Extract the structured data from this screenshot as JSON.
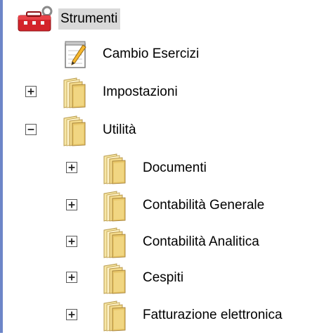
{
  "tree": {
    "root": {
      "label": "Strumenti",
      "icon": "toolbox-icon",
      "state": "selected"
    },
    "items": [
      {
        "label": "Cambio Esercizi",
        "icon": "notepad-pencil-icon",
        "expander": "none"
      },
      {
        "label": "Impostazioni",
        "icon": "folder-icon",
        "expander": "plus"
      },
      {
        "label": "Utilità",
        "icon": "folder-icon",
        "expander": "minus"
      }
    ],
    "utilita_children": [
      {
        "label": "Documenti",
        "icon": "folder-icon",
        "expander": "plus"
      },
      {
        "label": "Contabilità Generale",
        "icon": "folder-icon",
        "expander": "plus"
      },
      {
        "label": "Contabilità Analitica",
        "icon": "folder-icon",
        "expander": "plus"
      },
      {
        "label": "Cespiti",
        "icon": "folder-icon",
        "expander": "plus"
      },
      {
        "label": "Fatturazione elettronica",
        "icon": "folder-icon",
        "expander": "plus"
      }
    ]
  },
  "colors": {
    "selection_background": "#d9d9d9",
    "left_rule": "#6d86c8",
    "folder_light": "#fbeaa5",
    "folder_dark": "#d6b35a",
    "toolbox_red": "#d3232a"
  }
}
